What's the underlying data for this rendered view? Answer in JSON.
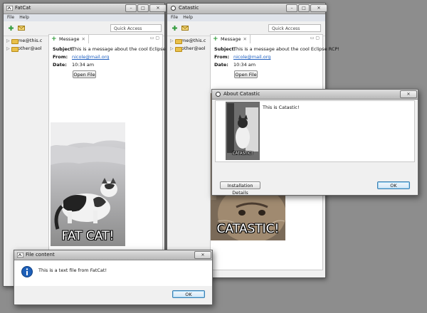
{
  "fatcat_window": {
    "title": "FatCat",
    "menu": [
      "File",
      "Help"
    ],
    "quick_access": "Quick Access",
    "tree": [
      "me@this.c",
      "other@aol"
    ],
    "tab_label": "Message",
    "subject_label": "Subject:",
    "subject_value": "This is a message about the cool Eclipse RCP!",
    "from_label": "From:",
    "from_value": "nicole@mail.org",
    "date_label": "Date:",
    "date_value": "10:34 am",
    "open_file_label": "Open File",
    "image_caption": "FAT CAT!"
  },
  "catastic_window": {
    "title": "Catastic",
    "menu": [
      "File",
      "Help"
    ],
    "quick_access": "Quick Access",
    "tree": [
      "me@this.c",
      "other@aol"
    ],
    "tab_label": "Message",
    "subject_label": "Subject:",
    "subject_value": "This is a message about the cool Eclipse RCP!",
    "from_label": "From:",
    "from_value": "nicole@mail.org",
    "date_label": "Date:",
    "date_value": "10:34 am",
    "open_file_label": "Open File",
    "image_caption": "CATASTIC!"
  },
  "about_dialog": {
    "title": "About Catastic",
    "text": "This is Catastic!",
    "thumb_caption": "CATASTIC!",
    "installation_details_label": "Installation Details",
    "ok_label": "OK"
  },
  "file_dialog": {
    "title": "File content",
    "message": "This is a text file from FatCat!",
    "ok_label": "OK"
  },
  "colors": {
    "desktop": "#8d8d8d",
    "link": "#1f5fbf",
    "info_icon": "#1d5fb8",
    "new_icon": "#2f9a3a"
  },
  "icons": [
    "app-icon",
    "new-message-icon",
    "envelope-icon",
    "folder-icon",
    "info-icon",
    "minimize-icon",
    "maximize-icon",
    "close-icon"
  ]
}
